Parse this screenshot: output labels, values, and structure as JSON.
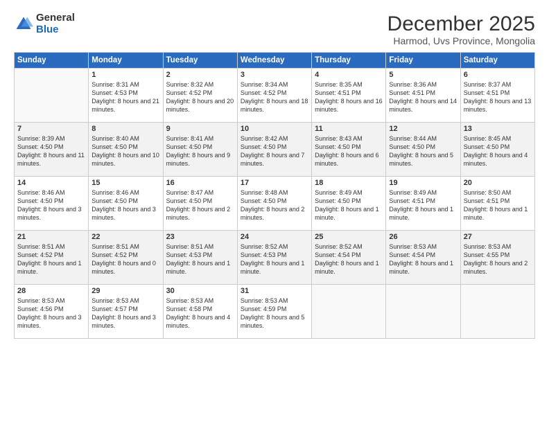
{
  "logo": {
    "general": "General",
    "blue": "Blue"
  },
  "title": "December 2025",
  "subtitle": "Harmod, Uvs Province, Mongolia",
  "days": [
    "Sunday",
    "Monday",
    "Tuesday",
    "Wednesday",
    "Thursday",
    "Friday",
    "Saturday"
  ],
  "weeks": [
    [
      {
        "num": "",
        "sunrise": "",
        "sunset": "",
        "daylight": ""
      },
      {
        "num": "1",
        "sunrise": "Sunrise: 8:31 AM",
        "sunset": "Sunset: 4:53 PM",
        "daylight": "Daylight: 8 hours and 21 minutes."
      },
      {
        "num": "2",
        "sunrise": "Sunrise: 8:32 AM",
        "sunset": "Sunset: 4:52 PM",
        "daylight": "Daylight: 8 hours and 20 minutes."
      },
      {
        "num": "3",
        "sunrise": "Sunrise: 8:34 AM",
        "sunset": "Sunset: 4:52 PM",
        "daylight": "Daylight: 8 hours and 18 minutes."
      },
      {
        "num": "4",
        "sunrise": "Sunrise: 8:35 AM",
        "sunset": "Sunset: 4:51 PM",
        "daylight": "Daylight: 8 hours and 16 minutes."
      },
      {
        "num": "5",
        "sunrise": "Sunrise: 8:36 AM",
        "sunset": "Sunset: 4:51 PM",
        "daylight": "Daylight: 8 hours and 14 minutes."
      },
      {
        "num": "6",
        "sunrise": "Sunrise: 8:37 AM",
        "sunset": "Sunset: 4:51 PM",
        "daylight": "Daylight: 8 hours and 13 minutes."
      }
    ],
    [
      {
        "num": "7",
        "sunrise": "Sunrise: 8:39 AM",
        "sunset": "Sunset: 4:50 PM",
        "daylight": "Daylight: 8 hours and 11 minutes."
      },
      {
        "num": "8",
        "sunrise": "Sunrise: 8:40 AM",
        "sunset": "Sunset: 4:50 PM",
        "daylight": "Daylight: 8 hours and 10 minutes."
      },
      {
        "num": "9",
        "sunrise": "Sunrise: 8:41 AM",
        "sunset": "Sunset: 4:50 PM",
        "daylight": "Daylight: 8 hours and 9 minutes."
      },
      {
        "num": "10",
        "sunrise": "Sunrise: 8:42 AM",
        "sunset": "Sunset: 4:50 PM",
        "daylight": "Daylight: 8 hours and 7 minutes."
      },
      {
        "num": "11",
        "sunrise": "Sunrise: 8:43 AM",
        "sunset": "Sunset: 4:50 PM",
        "daylight": "Daylight: 8 hours and 6 minutes."
      },
      {
        "num": "12",
        "sunrise": "Sunrise: 8:44 AM",
        "sunset": "Sunset: 4:50 PM",
        "daylight": "Daylight: 8 hours and 5 minutes."
      },
      {
        "num": "13",
        "sunrise": "Sunrise: 8:45 AM",
        "sunset": "Sunset: 4:50 PM",
        "daylight": "Daylight: 8 hours and 4 minutes."
      }
    ],
    [
      {
        "num": "14",
        "sunrise": "Sunrise: 8:46 AM",
        "sunset": "Sunset: 4:50 PM",
        "daylight": "Daylight: 8 hours and 3 minutes."
      },
      {
        "num": "15",
        "sunrise": "Sunrise: 8:46 AM",
        "sunset": "Sunset: 4:50 PM",
        "daylight": "Daylight: 8 hours and 3 minutes."
      },
      {
        "num": "16",
        "sunrise": "Sunrise: 8:47 AM",
        "sunset": "Sunset: 4:50 PM",
        "daylight": "Daylight: 8 hours and 2 minutes."
      },
      {
        "num": "17",
        "sunrise": "Sunrise: 8:48 AM",
        "sunset": "Sunset: 4:50 PM",
        "daylight": "Daylight: 8 hours and 2 minutes."
      },
      {
        "num": "18",
        "sunrise": "Sunrise: 8:49 AM",
        "sunset": "Sunset: 4:50 PM",
        "daylight": "Daylight: 8 hours and 1 minute."
      },
      {
        "num": "19",
        "sunrise": "Sunrise: 8:49 AM",
        "sunset": "Sunset: 4:51 PM",
        "daylight": "Daylight: 8 hours and 1 minute."
      },
      {
        "num": "20",
        "sunrise": "Sunrise: 8:50 AM",
        "sunset": "Sunset: 4:51 PM",
        "daylight": "Daylight: 8 hours and 1 minute."
      }
    ],
    [
      {
        "num": "21",
        "sunrise": "Sunrise: 8:51 AM",
        "sunset": "Sunset: 4:52 PM",
        "daylight": "Daylight: 8 hours and 1 minute."
      },
      {
        "num": "22",
        "sunrise": "Sunrise: 8:51 AM",
        "sunset": "Sunset: 4:52 PM",
        "daylight": "Daylight: 8 hours and 0 minutes."
      },
      {
        "num": "23",
        "sunrise": "Sunrise: 8:51 AM",
        "sunset": "Sunset: 4:53 PM",
        "daylight": "Daylight: 8 hours and 1 minute."
      },
      {
        "num": "24",
        "sunrise": "Sunrise: 8:52 AM",
        "sunset": "Sunset: 4:53 PM",
        "daylight": "Daylight: 8 hours and 1 minute."
      },
      {
        "num": "25",
        "sunrise": "Sunrise: 8:52 AM",
        "sunset": "Sunset: 4:54 PM",
        "daylight": "Daylight: 8 hours and 1 minute."
      },
      {
        "num": "26",
        "sunrise": "Sunrise: 8:53 AM",
        "sunset": "Sunset: 4:54 PM",
        "daylight": "Daylight: 8 hours and 1 minute."
      },
      {
        "num": "27",
        "sunrise": "Sunrise: 8:53 AM",
        "sunset": "Sunset: 4:55 PM",
        "daylight": "Daylight: 8 hours and 2 minutes."
      }
    ],
    [
      {
        "num": "28",
        "sunrise": "Sunrise: 8:53 AM",
        "sunset": "Sunset: 4:56 PM",
        "daylight": "Daylight: 8 hours and 3 minutes."
      },
      {
        "num": "29",
        "sunrise": "Sunrise: 8:53 AM",
        "sunset": "Sunset: 4:57 PM",
        "daylight": "Daylight: 8 hours and 3 minutes."
      },
      {
        "num": "30",
        "sunrise": "Sunrise: 8:53 AM",
        "sunset": "Sunset: 4:58 PM",
        "daylight": "Daylight: 8 hours and 4 minutes."
      },
      {
        "num": "31",
        "sunrise": "Sunrise: 8:53 AM",
        "sunset": "Sunset: 4:59 PM",
        "daylight": "Daylight: 8 hours and 5 minutes."
      },
      {
        "num": "",
        "sunrise": "",
        "sunset": "",
        "daylight": ""
      },
      {
        "num": "",
        "sunrise": "",
        "sunset": "",
        "daylight": ""
      },
      {
        "num": "",
        "sunrise": "",
        "sunset": "",
        "daylight": ""
      }
    ]
  ]
}
